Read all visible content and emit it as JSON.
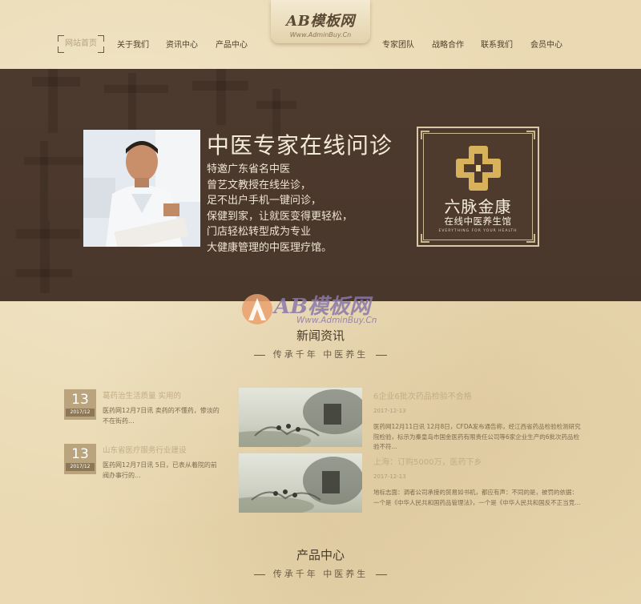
{
  "header": {
    "logo": "AB模板网",
    "logo_url": "Www.AdminBuy.Cn",
    "nav_left": [
      "网站首页",
      "关于我们",
      "资讯中心",
      "产品中心"
    ],
    "nav_right": [
      "专家团队",
      "战略合作",
      "联系我们",
      "会员中心"
    ]
  },
  "banner": {
    "title": "中医专家在线问诊",
    "lines": [
      "特邀广东省名中医",
      "曾艺文教授在线坐诊，",
      "足不出户手机一键问诊，",
      "保健到家，让就医变得更轻松，",
      "门店轻松转型成为专业",
      "大健康管理的中医理疗馆。"
    ],
    "brand_name": "六脉金康",
    "brand_sub": "在线中医养生馆",
    "brand_tagline": "EVERYTHING FOR YOUR HEALTH"
  },
  "watermark": {
    "text": "AB模板网",
    "url": "Www.AdminBuy.Cn"
  },
  "news_section": {
    "title": "新闻资讯",
    "subtitle": "传承千年 中医养生",
    "left_items": [
      {
        "day": "13",
        "ym": "2017/12",
        "title": "葛药治生活质量 实用的",
        "desc": "医药网12月7日讯 卖药的不懂药，惨淡的不在街药..."
      },
      {
        "day": "13",
        "ym": "2017/12",
        "title": "山东省医疗服务行业建设",
        "desc": "医药网12月7日讯 5日，已表从着院的前阀办事行的..."
      }
    ],
    "right_items": [
      {
        "title": "6企业6批次药品检验不合格",
        "date": "2017-12-13",
        "desc": "医药网12月11日讯 12月8日，CFDA发布通告称，经江西省药品检验检测研究院检验，标示为秦皇岛市国金医药有限责任公司等6家企业生产的6批次药品检验不符..."
      },
      {
        "title": "上海：订购5000万，医药下乡",
        "date": "2017-12-13",
        "desc": "地标志面：调者公司承接的贸易如书机，都应有声：不同的是，被罚的依据：一个是《中华人民共和国药品管理法》，一个是《中华人民共和国反不正当竞..."
      }
    ]
  },
  "product_section": {
    "title": "产品中心",
    "subtitle": "传承千年 中医养生"
  },
  "colors": {
    "background": "#ead9b2",
    "banner": "#4b382c",
    "accent": "#b9a47e"
  }
}
